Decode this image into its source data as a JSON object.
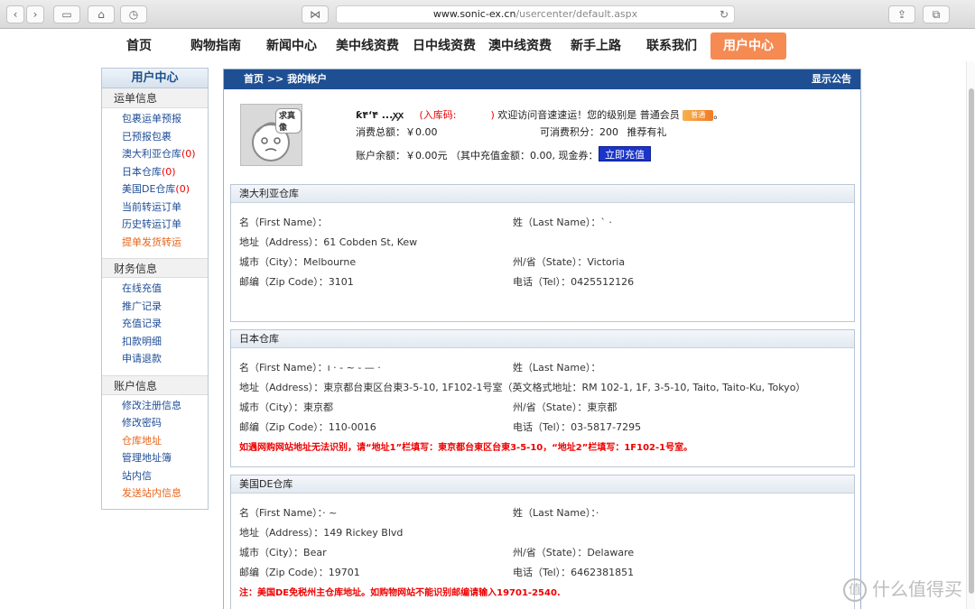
{
  "browser": {
    "url_host": "www.sonic-ex.cn",
    "url_path": "/usercenter/default.aspx"
  },
  "nav": [
    {
      "label": "首页"
    },
    {
      "label": "购物指南"
    },
    {
      "label": "新闻中心"
    },
    {
      "label": "美中线资费"
    },
    {
      "label": "日中线资费"
    },
    {
      "label": "澳中线资费"
    },
    {
      "label": "新手上路"
    },
    {
      "label": "联系我们"
    },
    {
      "label": "用户中心"
    }
  ],
  "sidebar": {
    "title": "用户中心",
    "sections": [
      {
        "title": "运单信息",
        "items": [
          {
            "label": "包裹运单预报"
          },
          {
            "label": "已预报包裹"
          },
          {
            "label": "澳大利亚仓库",
            "count": "(0)"
          },
          {
            "label": "日本仓库",
            "count": "(0)"
          },
          {
            "label": "美国DE仓库",
            "count": "(0)"
          },
          {
            "label": "当前转运订单"
          },
          {
            "label": "历史转运订单"
          },
          {
            "label": "提单发货转运"
          }
        ]
      },
      {
        "title": "财务信息",
        "items": [
          {
            "label": "在线充值"
          },
          {
            "label": "推广记录"
          },
          {
            "label": "充值记录"
          },
          {
            "label": "扣款明细"
          },
          {
            "label": "申请退款"
          }
        ]
      },
      {
        "title": "账户信息",
        "items": [
          {
            "label": "修改注册信息"
          },
          {
            "label": "修改密码"
          },
          {
            "label": "仓库地址"
          },
          {
            "label": "管理地址簿"
          },
          {
            "label": "站内信"
          },
          {
            "label": "发送站内信息"
          }
        ]
      }
    ]
  },
  "main": {
    "breadcrumb": "首页 >> 我的帐户",
    "announcement": "显示公告",
    "avatar_label": "求真像",
    "user_name": "ƙ۴ʻ۴  ...ꭗꭗ",
    "entry_code_label": "(入库码:",
    "entry_code_end": ")",
    "welcome": "欢迎访问音速速运！您的级别是 普通会员",
    "vip_badge": "普通",
    "welcome_end": "。",
    "total_spent": "消费总额：￥0.00",
    "points": "可消费积分：200",
    "points_link": "推荐有礼",
    "balance": "账户余额：￥0.00元 （其中充值金额：0.00, 现金券：0.00）",
    "recharge_button": "立即充值"
  },
  "warehouses": {
    "au": {
      "title": "澳大利亚仓库",
      "first_name": "名（First Name）：",
      "last_name": "姓（Last Name）：` ·",
      "address": "地址（Address）：61 Cobden St, Kew",
      "city": "城市（City）：Melbourne",
      "state": "州/省（State）：Victoria",
      "zip": "邮编（Zip Code）：3101",
      "phone": "电话（Tel）：0425512126"
    },
    "jp": {
      "title": "日本仓库",
      "first_name": "名（First Name）：ı ·  - ~ - — ·",
      "last_name": "姓（Last Name）：",
      "address": "地址（Address）：東京都台東区台東3-5-10, 1F102-1号室（英文格式地址：RM 102-1, 1F, 3-5-10, Taito, Taito-Ku, Tokyo）",
      "city": "城市（City）：東京都",
      "state": "州/省（State）：東京都",
      "zip": "邮编（Zip Code）：110-0016",
      "phone": "电话（Tel）：03-5817-7295",
      "note": "如遇网购网站地址无法识别，请“地址1”栏填写：東京都台東区台東3-5-10，“地址2”栏填写：1F102-1号室。"
    },
    "us": {
      "title": "美国DE仓库",
      "first_name": "名（First Name）：·                 ~",
      "last_name": "姓（Last Name）：·",
      "address": "地址（Address）：149 Rickey Blvd",
      "city": "城市（City）：Bear",
      "state": "州/省（State）：Delaware",
      "zip": "邮编（Zip Code）：19701",
      "phone": "电话（Tel）：6462381851",
      "note": "注：美国DE免税州主仓库地址。如购物网站不能识别邮编请输入19701-2540."
    }
  },
  "watermark": "什么值得买",
  "watermark_logo": "值"
}
